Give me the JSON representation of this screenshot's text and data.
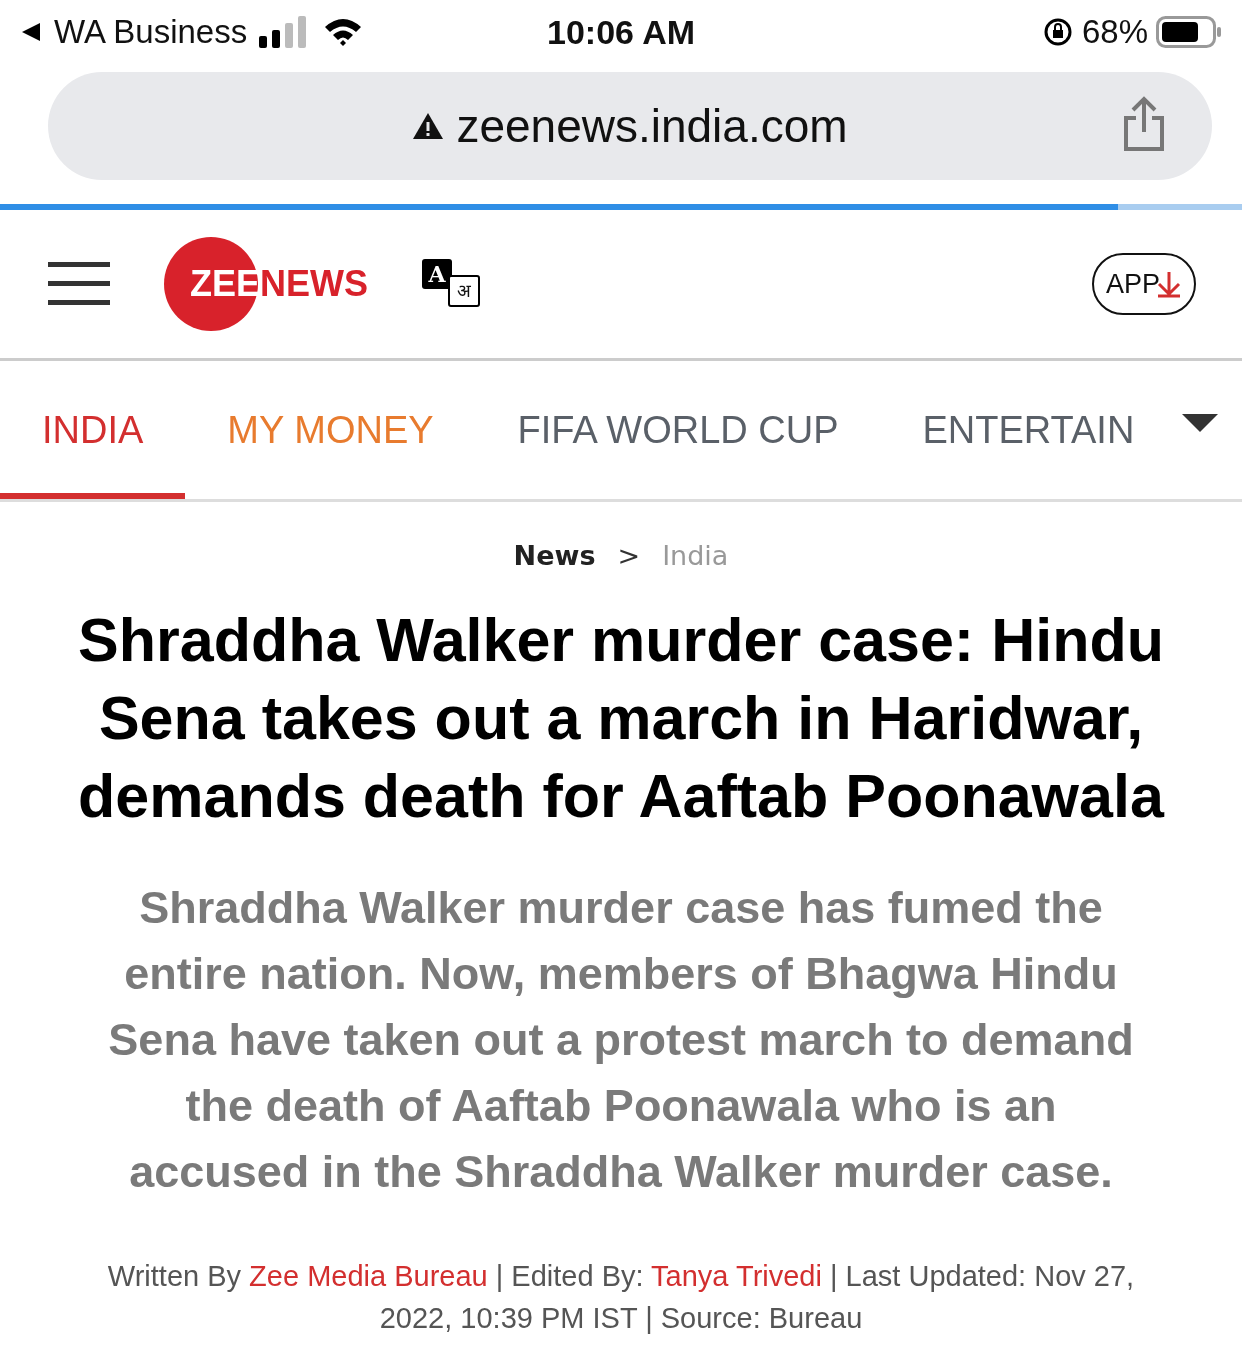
{
  "status_bar": {
    "back_app": "WA Business",
    "time": "10:06 AM",
    "battery": "68%"
  },
  "address_bar": {
    "url": "zeenews.india.com"
  },
  "page_load": {
    "level": 0.9
  },
  "header": {
    "logo_parts": [
      {
        "text": "ZEE",
        "kind": "inside"
      },
      {
        "text": "NEWS",
        "kind": "outside"
      }
    ],
    "translate_glyphs": [
      "A",
      "अ"
    ],
    "app_button": "APP"
  },
  "tabs": [
    {
      "label": "INDIA",
      "selected": true,
      "color": "#d32f2f"
    },
    {
      "label": "MY MONEY",
      "selected": false,
      "color": "#e87b2e"
    },
    {
      "label": "FIFA WORLD CUP",
      "selected": false,
      "color": "#5a6068"
    },
    {
      "label": "ENTERTAIN",
      "selected": false,
      "color": "#5a6068"
    }
  ],
  "breadcrumb": [
    {
      "text": "News",
      "kind": "link"
    },
    {
      "text": ">",
      "kind": "separator"
    },
    {
      "text": "India",
      "kind": "current"
    }
  ],
  "article": {
    "headline": "Shraddha Walker murder case: Hindu Sena takes out a march in Haridwar, demands death for Aaftab Poonawala",
    "summary": "Shraddha Walker murder case has fumed the entire nation. Now, members of Bhagwa Hindu Sena have taken out a protest march to demand the death of Aaftab Poonawala who is an accused in the Shraddha Walker murder case.",
    "byline": [
      {
        "text": "Written By ",
        "kind": "plain"
      },
      {
        "text": "Zee Media Bureau",
        "kind": "link"
      },
      {
        "text": " | Edited By: ",
        "kind": "plain"
      },
      {
        "text": "Tanya Trivedi",
        "kind": "link"
      },
      {
        "text": "  | Last Updated: Nov 27, 2022, 10:39 PM IST  | Source: Bureau",
        "kind": "plain"
      }
    ]
  }
}
